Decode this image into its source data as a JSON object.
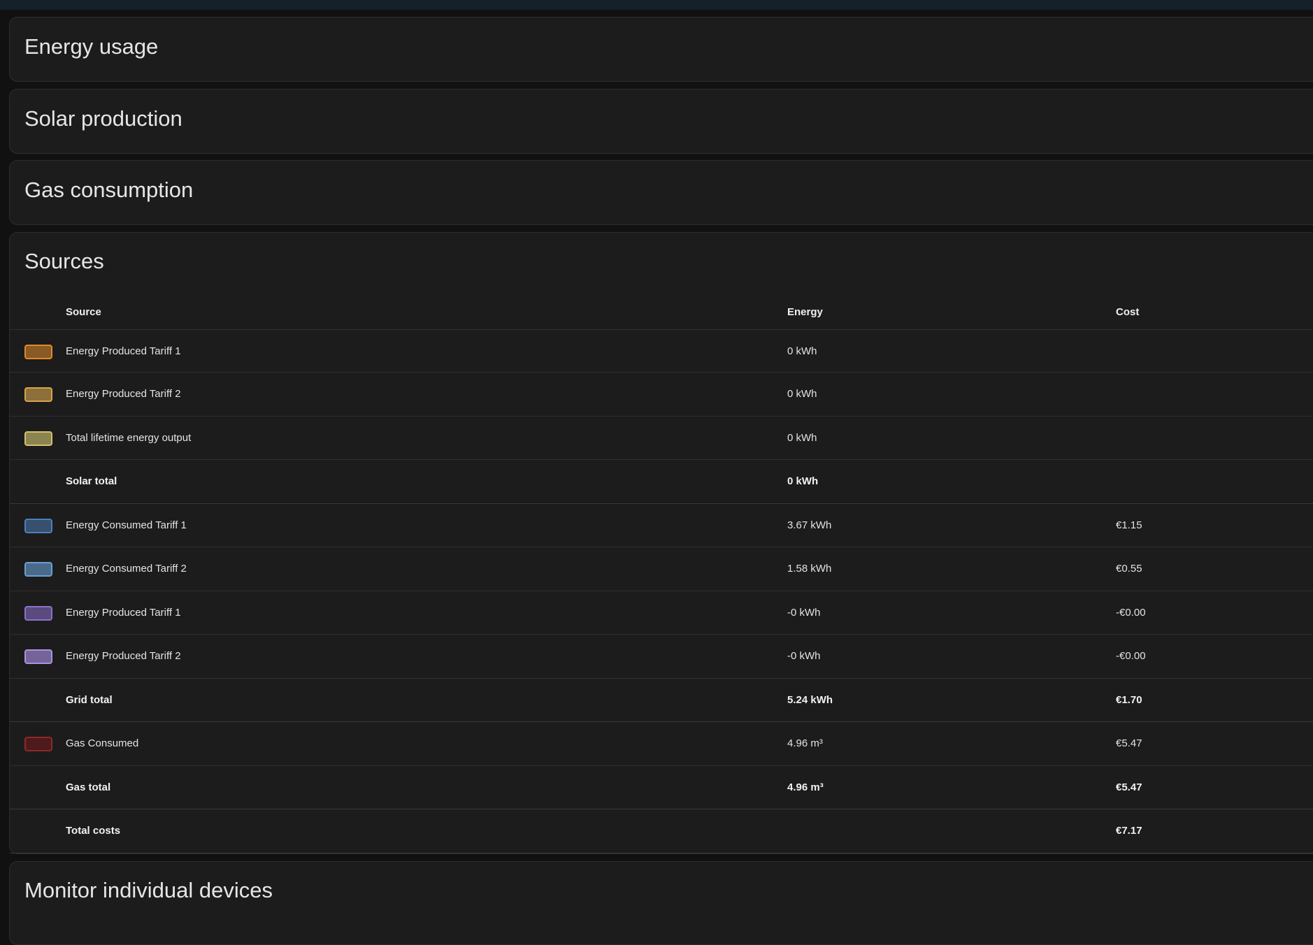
{
  "cards": {
    "energy_usage": "Energy usage",
    "solar_production": "Solar production",
    "gas_consumption": "Gas consumption",
    "sources": "Sources",
    "monitor_devices": "Monitor individual devices"
  },
  "table": {
    "headers": {
      "source": "Source",
      "energy": "Energy",
      "cost": "Cost"
    },
    "rows": [
      {
        "name": "Energy Produced Tariff 1",
        "energy": "0 kWh",
        "cost": "",
        "color": "#e08a28",
        "fill": "#8a5a24",
        "total": false
      },
      {
        "name": "Energy Produced Tariff 2",
        "energy": "0 kWh",
        "cost": "",
        "color": "#d9a44a",
        "fill": "#8c6f3a",
        "total": false
      },
      {
        "name": "Total lifetime energy output",
        "energy": "0 kWh",
        "cost": "",
        "color": "#d4c070",
        "fill": "#8b8350",
        "total": false
      },
      {
        "name": "Solar total",
        "energy": "0 kWh",
        "cost": "",
        "color": "",
        "fill": "",
        "total": true
      },
      {
        "name": "Energy Consumed Tariff 1",
        "energy": "3.67 kWh",
        "cost": "€1.15",
        "color": "#4c7fbf",
        "fill": "#36506e",
        "total": false
      },
      {
        "name": "Energy Consumed Tariff 2",
        "energy": "1.58 kWh",
        "cost": "€0.55",
        "color": "#6a9fd6",
        "fill": "#4a6a8a",
        "total": false
      },
      {
        "name": "Energy Produced Tariff 1",
        "energy": "-0 kWh",
        "cost": "-€0.00",
        "color": "#8a72c8",
        "fill": "#5a4a7e",
        "total": false
      },
      {
        "name": "Energy Produced Tariff 2",
        "energy": "-0 kWh",
        "cost": "-€0.00",
        "color": "#a894dc",
        "fill": "#75649a",
        "total": false
      },
      {
        "name": "Grid total",
        "energy": "5.24 kWh",
        "cost": "€1.70",
        "color": "",
        "fill": "",
        "total": true
      },
      {
        "name": "Gas Consumed",
        "energy": "4.96 m³",
        "cost": "€5.47",
        "color": "#8c2a2a",
        "fill": "#4e1a1c",
        "total": false
      },
      {
        "name": "Gas total",
        "energy": "4.96 m³",
        "cost": "€5.47",
        "color": "",
        "fill": "",
        "total": true
      },
      {
        "name": "Total costs",
        "energy": "",
        "cost": "€7.17",
        "color": "",
        "fill": "",
        "total": true
      }
    ]
  }
}
